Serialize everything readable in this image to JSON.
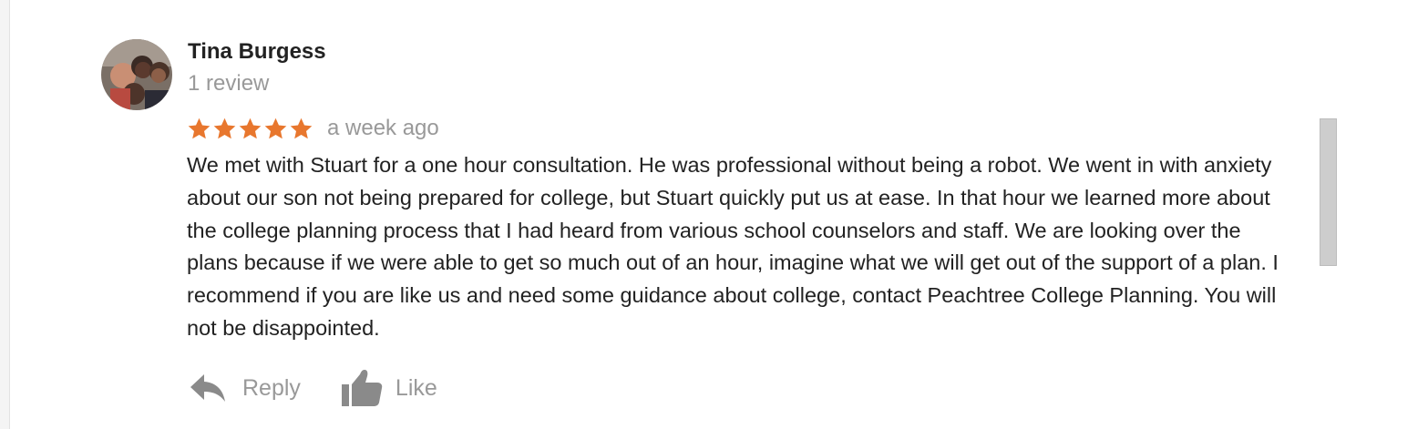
{
  "review": {
    "author": {
      "name": "Tina Burgess",
      "review_count": "1 review",
      "avatar_icon": "user-photo-avatar"
    },
    "rating": {
      "stars": 5,
      "max_stars": 5,
      "star_color": "#e8772e"
    },
    "time_ago": "a week ago",
    "text": "We met with Stuart for a one hour consultation. He was professional without being a robot. We went in with anxiety about our son not being prepared for college, but Stuart quickly put us at ease. In that hour we learned more about the college planning process that I had heard from various school counselors and staff. We are looking over the plans because if we were able to get so much out of an hour, imagine what we will get out of the support of a plan. I recommend if you are like us and need some guidance about college, contact Peachtree College Planning. You will not be disappointed."
  },
  "actions": {
    "reply": {
      "label": "Reply",
      "icon": "reply-arrow-icon"
    },
    "like": {
      "label": "Like",
      "icon": "thumbs-up-icon"
    }
  },
  "colors": {
    "text": "#222222",
    "muted": "#999999",
    "star": "#e8772e",
    "icon": "#8a8a8a",
    "scrollbar": "#cdcdcd"
  }
}
